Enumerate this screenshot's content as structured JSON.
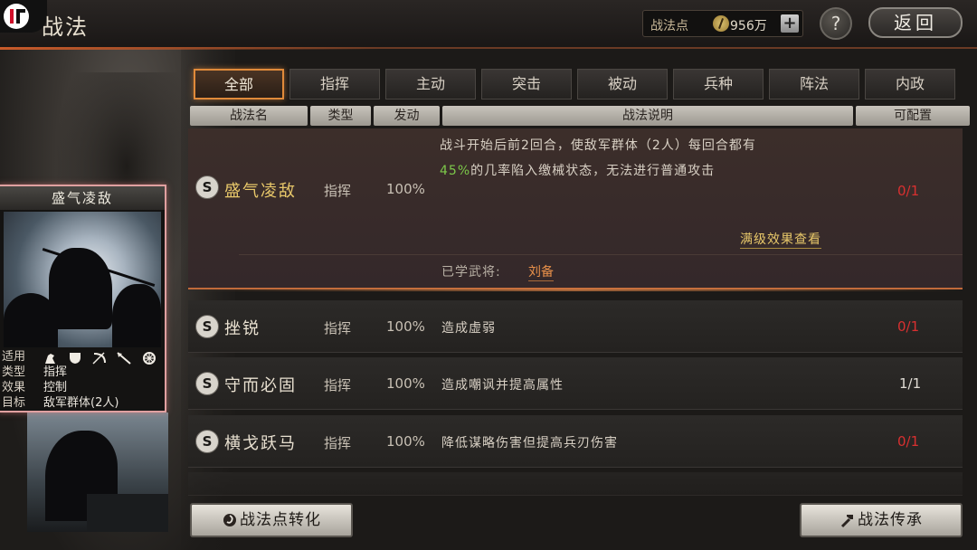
{
  "header": {
    "title": "战法",
    "points_label": "战法点",
    "points_value": "956万",
    "plus": "+",
    "help": "?",
    "back": "返回"
  },
  "tabs": [
    {
      "label": "全部",
      "active": true
    },
    {
      "label": "指挥",
      "active": false
    },
    {
      "label": "主动",
      "active": false
    },
    {
      "label": "突击",
      "active": false
    },
    {
      "label": "被动",
      "active": false
    },
    {
      "label": "兵种",
      "active": false
    },
    {
      "label": "阵法",
      "active": false
    },
    {
      "label": "内政",
      "active": false
    }
  ],
  "columns": {
    "name": "战法名",
    "type": "类型",
    "trigger": "发动",
    "description": "战法说明",
    "configurable": "可配置"
  },
  "skills": [
    {
      "grade": "S",
      "name": "盛气凌敌",
      "type": "指挥",
      "rate": "100%",
      "desc_line1": "战斗开始后前2回合，使敌军群体（2人）每回合都有",
      "desc_line2_pct": "45%",
      "desc_line2_rest": "的几率陷入缴械状态，无法进行普通攻击",
      "full_effect_link": "满级效果查看",
      "learned_label": "已学武将:",
      "learned_general": "刘备",
      "count": "0/1"
    },
    {
      "grade": "S",
      "name": "挫锐",
      "type": "指挥",
      "rate": "100%",
      "desc": "造成虚弱",
      "count": "0/1"
    },
    {
      "grade": "S",
      "name": "守而必固",
      "type": "指挥",
      "rate": "100%",
      "desc": "造成嘲讽并提高属性",
      "count": "1/1"
    },
    {
      "grade": "S",
      "name": "横戈跃马",
      "type": "指挥",
      "rate": "100%",
      "desc": "降低谋略伤害但提高兵刃伤害",
      "count": "0/1"
    }
  ],
  "card": {
    "title": "盛气凌敌",
    "applies_label": "适用",
    "applies_icons": [
      "cavalry-icon",
      "shield-icon",
      "bow-icon",
      "spear-icon",
      "wheel-icon"
    ],
    "type_label": "类型",
    "type_value": "指挥",
    "effect_label": "效果",
    "effect_value": "控制",
    "target_label": "目标",
    "target_value": "敌军群体(2人)"
  },
  "buttons": {
    "convert": "战法点转化",
    "inherit": "战法传承"
  },
  "colors": {
    "accent_orange": "#e08a3a",
    "gold_text": "#e8c86a",
    "red_count": "#d83030",
    "green_pct": "#7cc84a"
  }
}
